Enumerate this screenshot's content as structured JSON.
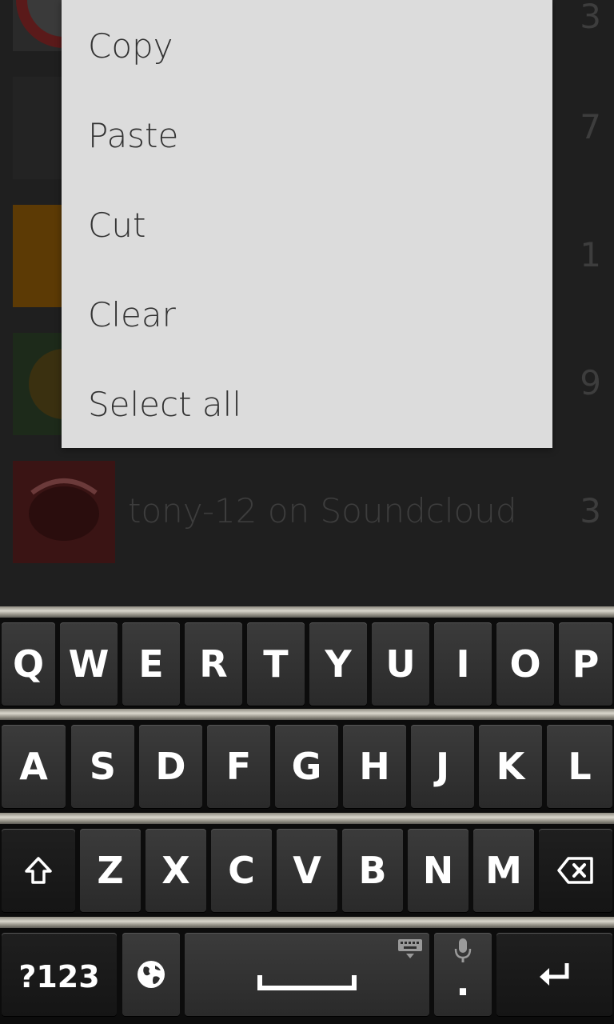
{
  "context_menu": {
    "items": [
      "Copy",
      "Paste",
      "Cut",
      "Clear",
      "Select all"
    ]
  },
  "background_list": {
    "counts": [
      "3",
      "7",
      "1",
      "9",
      "3"
    ],
    "last_item_title": "tony-12 on Soundcloud"
  },
  "keyboard": {
    "row1": [
      "Q",
      "W",
      "E",
      "R",
      "T",
      "Y",
      "U",
      "I",
      "O",
      "P"
    ],
    "row2": [
      "A",
      "S",
      "D",
      "F",
      "G",
      "H",
      "J",
      "K",
      "L"
    ],
    "row3": [
      "Z",
      "X",
      "C",
      "V",
      "B",
      "N",
      "M"
    ],
    "symbols_label": "?123",
    "period_label": ".",
    "icons": [
      "shift-icon",
      "backspace-icon",
      "globe-icon",
      "space-bar-icon",
      "keyboard-hide-icon",
      "microphone-icon",
      "enter-icon"
    ]
  },
  "colors": {
    "menu_bg": "#dcdcdc",
    "menu_text": "#333333",
    "keyboard_bg": "#0c0c0c",
    "key_bg": "#333333"
  }
}
